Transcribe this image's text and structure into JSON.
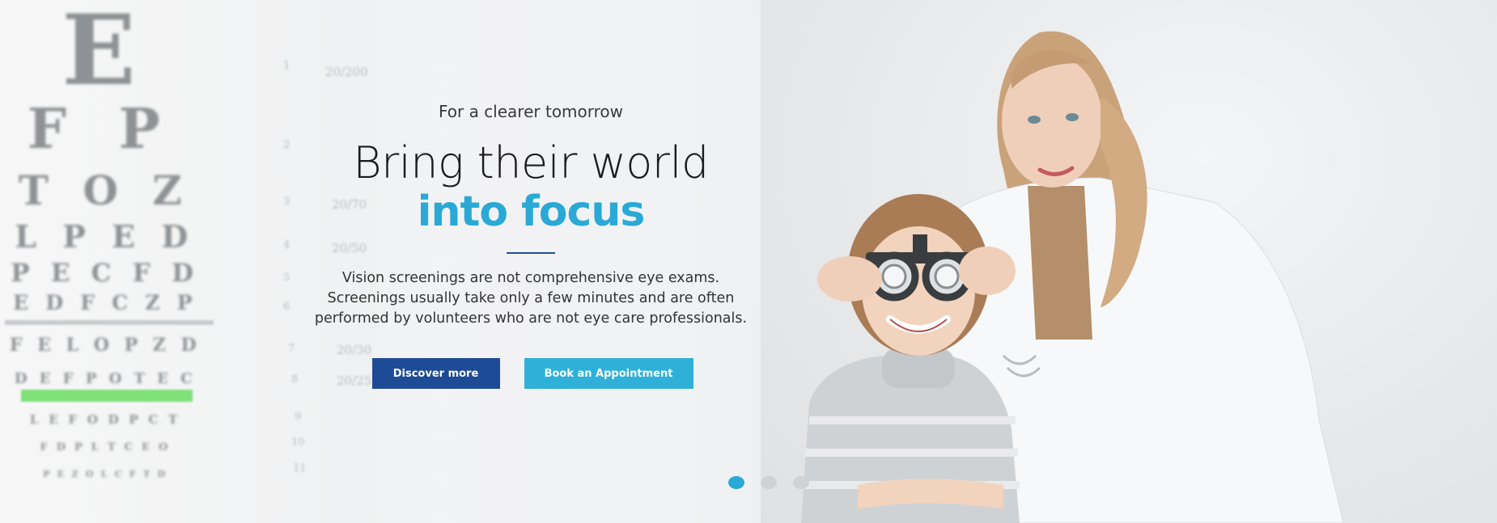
{
  "hero": {
    "kicker": "For a clearer tomorrow",
    "headline_line1": "Bring their world",
    "headline_line2": "into focus",
    "description": [
      "Vision screenings are not comprehensive eye exams.",
      "Screenings usually take only a few minutes and are often",
      "performed by volunteers who are not eye care professionals."
    ],
    "buttons": {
      "discover": "Discover more",
      "book": "Book an Appointment"
    }
  },
  "eye_chart": {
    "rows": [
      "E",
      "F  P",
      "T O Z",
      "L P E D",
      "P E C F D",
      "E D F C Z P",
      "F E L O P Z D",
      "D E F P O T E C",
      "L E F O D P C T",
      "F D P L T C E O",
      "P E Z O L C F T D"
    ],
    "numbers": [
      "1",
      "20/200",
      "2",
      "3",
      "20/70",
      "4",
      "20/50",
      "5",
      "6",
      "7",
      "20/30",
      "8",
      "20/25",
      "9",
      "10",
      "11"
    ]
  },
  "carousel": {
    "slides": 3,
    "active": 1
  },
  "colors": {
    "accent": "#2aa9d6",
    "primary_button": "#1e4b95",
    "secondary_button": "#2fb0d9"
  }
}
